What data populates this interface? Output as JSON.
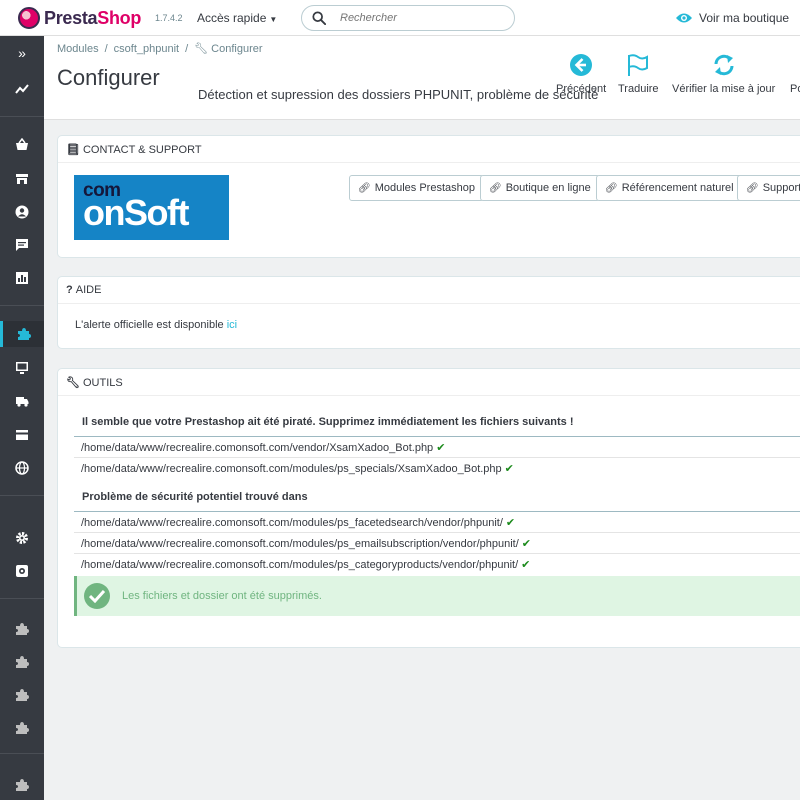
{
  "header": {
    "logo_prefix": "Presta",
    "logo_suffix": "Shop",
    "version": "1.7.4.2",
    "quick_access": "Accès rapide",
    "search_placeholder": "Rechercher",
    "view_shop": "Voir ma boutique"
  },
  "breadcrumb": [
    "Modules",
    "csoft_phpunit",
    "Configurer"
  ],
  "page": {
    "title": "Configurer",
    "description": "Détection et supression des dossiers PHPUNIT, problème de sécurité"
  },
  "toolbar": [
    {
      "label": "Précédent",
      "icon": "arrow-left-circle-icon"
    },
    {
      "label": "Traduire",
      "icon": "flag-icon"
    },
    {
      "label": "Vérifier la mise à jour",
      "icon": "refresh-icon"
    },
    {
      "label": "Poi",
      "icon": "none"
    }
  ],
  "contact": {
    "heading": "CONTACT & SUPPORT",
    "logo_top": "com",
    "logo_bottom": "onSoft",
    "links": [
      "Modules Prestashop",
      "Boutique en ligne",
      "Référencement naturel",
      "Support a"
    ]
  },
  "help": {
    "heading": "AIDE",
    "text": "L'alerte officielle est disponible",
    "link": "ici"
  },
  "tools": {
    "heading": "OUTILS",
    "hacked_title": "Il semble que votre Prestashop ait été piraté. Supprimez immédiatement les fichiers suivants !",
    "hacked_files": [
      "/home/data/www/recrealire.comonsoft.com/vendor/XsamXadoo_Bot.php",
      "/home/data/www/recrealire.comonsoft.com/modules/ps_specials/XsamXadoo_Bot.php"
    ],
    "security_title": "Problème de sécurité potentiel trouvé dans",
    "security_files": [
      "/home/data/www/recrealire.comonsoft.com/modules/ps_facetedsearch/vendor/phpunit/",
      "/home/data/www/recrealire.comonsoft.com/modules/ps_emailsubscription/vendor/phpunit/",
      "/home/data/www/recrealire.comonsoft.com/modules/ps_categoryproducts/vendor/phpunit/"
    ],
    "success_message": "Les fichiers et dossier ont été supprimés."
  },
  "colors": {
    "accent": "#25b9d7",
    "sidebar": "#363a41",
    "success": "#70b580",
    "brand": "#df0067"
  }
}
